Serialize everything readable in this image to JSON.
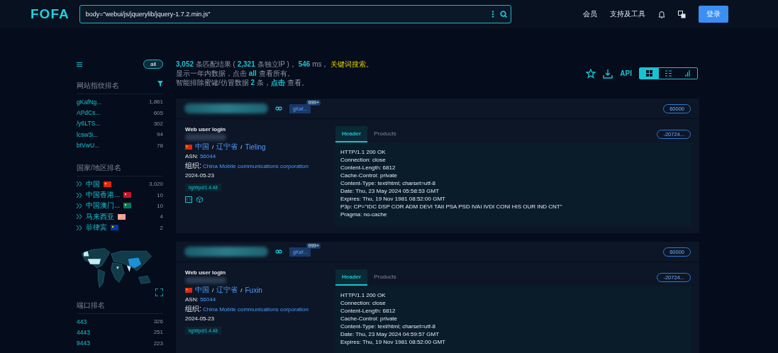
{
  "header": {
    "logo": "FOFA",
    "search": {
      "value": "body=\"webui/js/jquerylib/jquery-1.7.2.min.js\""
    },
    "nav": [
      "会员",
      "支持及工具"
    ],
    "login": "登录"
  },
  "sidebar": {
    "all_toggle": "all",
    "fingerprint": {
      "title": "网站指纹排名",
      "items": [
        {
          "name": "gKafNg...",
          "count": "1,861"
        },
        {
          "name": "APdCs...",
          "count": "605"
        },
        {
          "name": "/y6LTS...",
          "count": "302"
        },
        {
          "name": "lcsw3i...",
          "count": "94"
        },
        {
          "name": "btVwU...",
          "count": "78"
        }
      ]
    },
    "countries": {
      "title": "国家/地区排名",
      "items": [
        {
          "name": "中国",
          "count": "3,020",
          "color": "#de2910"
        },
        {
          "name": "中国香港...",
          "count": "10",
          "color": "#c8102e"
        },
        {
          "name": "中国澳门...",
          "count": "10",
          "color": "#00785e"
        },
        {
          "name": "马来西亚",
          "count": "4",
          "color": "#f2a0a0"
        },
        {
          "name": "菲律宾",
          "count": "2",
          "color": "#0038a8"
        }
      ]
    },
    "ports": {
      "title": "端口排名",
      "items": [
        {
          "name": "443",
          "count": "326"
        },
        {
          "name": "4443",
          "count": "251"
        },
        {
          "name": "9443",
          "count": "223"
        }
      ]
    }
  },
  "summary": {
    "line_1": "**3,052** 条匹配结果 ( **2,321** 条独立IP )， **546** ms， ",
    "line_1_link": "关键词搜索。",
    "line_2": "显示一年内数据，点击 **all** 查看所有。",
    "line_3": "智能排除蜜罐/仿冒数据 **2** 条，",
    "line_3_link": "点击",
    "line_3_end": " 查看。"
  },
  "toolbar": {
    "api": "API",
    "views": [
      {
        "selected": true
      },
      {
        "selected": false
      },
      {
        "selected": false
      }
    ]
  },
  "results": [
    {
      "tag": "gKaf...",
      "tag_badge": "999+",
      "port": "60000",
      "title": "Web user login",
      "location": [
        "中国",
        "辽宁省",
        "Tieling"
      ],
      "asn_label": "ASN:",
      "asn": "56044",
      "org_label": "组织:",
      "org": "China Mobile communications corporation",
      "date": "2024-05-23",
      "server": "lighttpd/1.4.48",
      "tabs": [
        {
          "label": "Header",
          "selected": true
        },
        {
          "label": "Products",
          "selected": false
        }
      ],
      "hash": "-20724...",
      "separators": [
        "/",
        "/"
      ],
      "header_lines": [
        "HTTP/1.1 200 OK",
        "Connection: close",
        "Content-Length: 6812",
        "Cache-Control: private",
        "Content-Type: text/html; charset=utf-8",
        "Date: Thu, 23 May 2024 05:58:53 GMT",
        "Expires: Thu, 19 Nov 1981 08:52:00 GMT",
        "P3p: CP=\"IDC DSP COR ADM DEVI TAII PSA PSD IVAI IVDI CONI HIS OUR IND CNT\"",
        "Pragma: no-cache"
      ]
    },
    {
      "tag": "gKaf...",
      "tag_badge": "999+",
      "port": "60000",
      "title": "Web user login",
      "location": [
        "中国",
        "辽宁省",
        "Fuxin"
      ],
      "asn_label": "ASN:",
      "asn": "56044",
      "org_label": "组织:",
      "org": "China Mobile communications corporation",
      "date": "2024-05-23",
      "server": "lighttpd/1.4.48",
      "tabs": [
        {
          "label": "Header",
          "selected": true
        },
        {
          "label": "Products",
          "selected": false
        }
      ],
      "hash": "-20724...",
      "separators": [
        "/",
        "/"
      ],
      "header_lines": [
        "HTTP/1.1 200 OK",
        "Connection: close",
        "Content-Length: 6812",
        "Cache-Control: private",
        "Content-Type: text/html; charset=utf-8",
        "Date: Thu, 23 May 2024 04:59:57 GMT",
        "Expires: Thu, 19 Nov 1981 08:52:00 GMT"
      ]
    }
  ]
}
